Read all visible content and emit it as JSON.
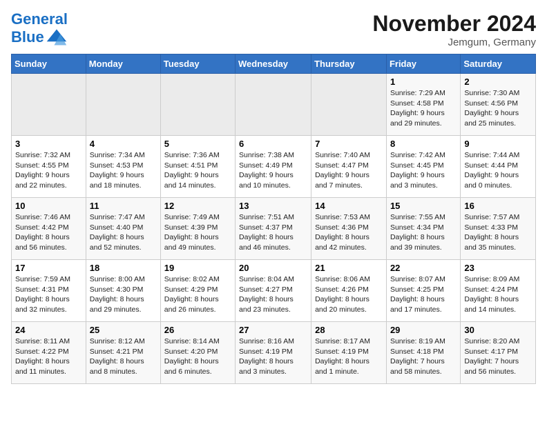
{
  "header": {
    "logo_line1": "General",
    "logo_line2": "Blue",
    "month_year": "November 2024",
    "location": "Jemgum, Germany"
  },
  "weekdays": [
    "Sunday",
    "Monday",
    "Tuesday",
    "Wednesday",
    "Thursday",
    "Friday",
    "Saturday"
  ],
  "weeks": [
    [
      {
        "day": "",
        "info": ""
      },
      {
        "day": "",
        "info": ""
      },
      {
        "day": "",
        "info": ""
      },
      {
        "day": "",
        "info": ""
      },
      {
        "day": "",
        "info": ""
      },
      {
        "day": "1",
        "info": "Sunrise: 7:29 AM\nSunset: 4:58 PM\nDaylight: 9 hours\nand 29 minutes."
      },
      {
        "day": "2",
        "info": "Sunrise: 7:30 AM\nSunset: 4:56 PM\nDaylight: 9 hours\nand 25 minutes."
      }
    ],
    [
      {
        "day": "3",
        "info": "Sunrise: 7:32 AM\nSunset: 4:55 PM\nDaylight: 9 hours\nand 22 minutes."
      },
      {
        "day": "4",
        "info": "Sunrise: 7:34 AM\nSunset: 4:53 PM\nDaylight: 9 hours\nand 18 minutes."
      },
      {
        "day": "5",
        "info": "Sunrise: 7:36 AM\nSunset: 4:51 PM\nDaylight: 9 hours\nand 14 minutes."
      },
      {
        "day": "6",
        "info": "Sunrise: 7:38 AM\nSunset: 4:49 PM\nDaylight: 9 hours\nand 10 minutes."
      },
      {
        "day": "7",
        "info": "Sunrise: 7:40 AM\nSunset: 4:47 PM\nDaylight: 9 hours\nand 7 minutes."
      },
      {
        "day": "8",
        "info": "Sunrise: 7:42 AM\nSunset: 4:45 PM\nDaylight: 9 hours\nand 3 minutes."
      },
      {
        "day": "9",
        "info": "Sunrise: 7:44 AM\nSunset: 4:44 PM\nDaylight: 9 hours\nand 0 minutes."
      }
    ],
    [
      {
        "day": "10",
        "info": "Sunrise: 7:46 AM\nSunset: 4:42 PM\nDaylight: 8 hours\nand 56 minutes."
      },
      {
        "day": "11",
        "info": "Sunrise: 7:47 AM\nSunset: 4:40 PM\nDaylight: 8 hours\nand 52 minutes."
      },
      {
        "day": "12",
        "info": "Sunrise: 7:49 AM\nSunset: 4:39 PM\nDaylight: 8 hours\nand 49 minutes."
      },
      {
        "day": "13",
        "info": "Sunrise: 7:51 AM\nSunset: 4:37 PM\nDaylight: 8 hours\nand 46 minutes."
      },
      {
        "day": "14",
        "info": "Sunrise: 7:53 AM\nSunset: 4:36 PM\nDaylight: 8 hours\nand 42 minutes."
      },
      {
        "day": "15",
        "info": "Sunrise: 7:55 AM\nSunset: 4:34 PM\nDaylight: 8 hours\nand 39 minutes."
      },
      {
        "day": "16",
        "info": "Sunrise: 7:57 AM\nSunset: 4:33 PM\nDaylight: 8 hours\nand 35 minutes."
      }
    ],
    [
      {
        "day": "17",
        "info": "Sunrise: 7:59 AM\nSunset: 4:31 PM\nDaylight: 8 hours\nand 32 minutes."
      },
      {
        "day": "18",
        "info": "Sunrise: 8:00 AM\nSunset: 4:30 PM\nDaylight: 8 hours\nand 29 minutes."
      },
      {
        "day": "19",
        "info": "Sunrise: 8:02 AM\nSunset: 4:29 PM\nDaylight: 8 hours\nand 26 minutes."
      },
      {
        "day": "20",
        "info": "Sunrise: 8:04 AM\nSunset: 4:27 PM\nDaylight: 8 hours\nand 23 minutes."
      },
      {
        "day": "21",
        "info": "Sunrise: 8:06 AM\nSunset: 4:26 PM\nDaylight: 8 hours\nand 20 minutes."
      },
      {
        "day": "22",
        "info": "Sunrise: 8:07 AM\nSunset: 4:25 PM\nDaylight: 8 hours\nand 17 minutes."
      },
      {
        "day": "23",
        "info": "Sunrise: 8:09 AM\nSunset: 4:24 PM\nDaylight: 8 hours\nand 14 minutes."
      }
    ],
    [
      {
        "day": "24",
        "info": "Sunrise: 8:11 AM\nSunset: 4:22 PM\nDaylight: 8 hours\nand 11 minutes."
      },
      {
        "day": "25",
        "info": "Sunrise: 8:12 AM\nSunset: 4:21 PM\nDaylight: 8 hours\nand 8 minutes."
      },
      {
        "day": "26",
        "info": "Sunrise: 8:14 AM\nSunset: 4:20 PM\nDaylight: 8 hours\nand 6 minutes."
      },
      {
        "day": "27",
        "info": "Sunrise: 8:16 AM\nSunset: 4:19 PM\nDaylight: 8 hours\nand 3 minutes."
      },
      {
        "day": "28",
        "info": "Sunrise: 8:17 AM\nSunset: 4:19 PM\nDaylight: 8 hours\nand 1 minute."
      },
      {
        "day": "29",
        "info": "Sunrise: 8:19 AM\nSunset: 4:18 PM\nDaylight: 7 hours\nand 58 minutes."
      },
      {
        "day": "30",
        "info": "Sunrise: 8:20 AM\nSunset: 4:17 PM\nDaylight: 7 hours\nand 56 minutes."
      }
    ]
  ]
}
